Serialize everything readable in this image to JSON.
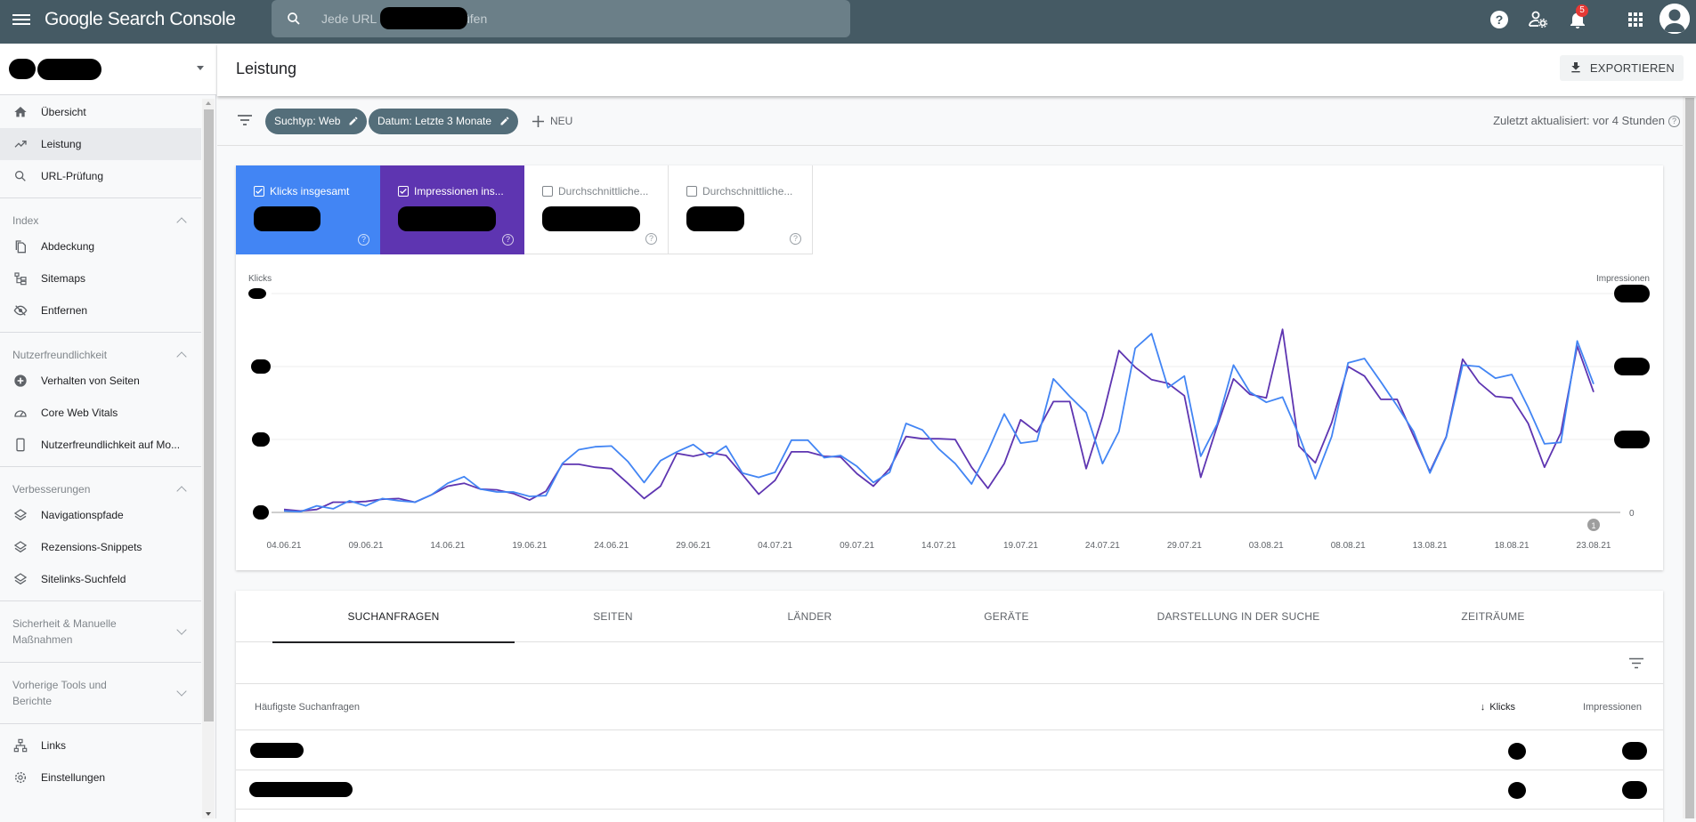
{
  "topbar": {
    "app_title": "Google Search Console",
    "search_placeholder": "Jede URL in [redacted] prüfen",
    "search_placeholder_prefix": "Jede URL in",
    "search_placeholder_suffix": "prüfen",
    "notification_count": "5",
    "icons": [
      "menu-icon",
      "search-icon",
      "help-icon",
      "user-settings-icon",
      "bell-icon",
      "apps-grid-icon",
      "account-avatar-icon"
    ]
  },
  "sidebar": {
    "property_redacted": true,
    "items_top": [
      {
        "label": "Übersicht",
        "icon": "home-icon"
      },
      {
        "label": "Leistung",
        "icon": "trending-up-icon",
        "active": true
      },
      {
        "label": "URL-Prüfung",
        "icon": "search-icon"
      }
    ],
    "sections": [
      {
        "title": "Index",
        "expanded": true,
        "items": [
          {
            "label": "Abdeckung",
            "icon": "copy-pages-icon"
          },
          {
            "label": "Sitemaps",
            "icon": "sitemap-icon"
          },
          {
            "label": "Entfernen",
            "icon": "visibility-off-icon"
          }
        ]
      },
      {
        "title": "Nutzerfreundlichkeit",
        "expanded": true,
        "items": [
          {
            "label": "Verhalten von Seiten",
            "icon": "add-circle-icon"
          },
          {
            "label": "Core Web Vitals",
            "icon": "speedometer-icon"
          },
          {
            "label": "Nutzerfreundlichkeit auf Mo...",
            "icon": "smartphone-icon"
          }
        ]
      },
      {
        "title": "Verbesserungen",
        "expanded": true,
        "items": [
          {
            "label": "Navigationspfade",
            "icon": "layers-icon"
          },
          {
            "label": "Rezensions-Snippets",
            "icon": "layers-icon"
          },
          {
            "label": "Sitelinks-Suchfeld",
            "icon": "layers-icon"
          }
        ]
      },
      {
        "title_line1": "Sicherheit & Manuelle",
        "title_line2": "Maßnahmen",
        "expanded": false
      },
      {
        "title_line1": "Vorherige Tools und",
        "title_line2": "Berichte",
        "expanded": false
      }
    ],
    "items_bottom": [
      {
        "label": "Links",
        "icon": "network-icon"
      },
      {
        "label": "Einstellungen",
        "icon": "gear-icon"
      }
    ]
  },
  "header": {
    "title": "Leistung",
    "export_label": "EXPORTIEREN"
  },
  "filters": {
    "chips": [
      "Suchtyp: Web",
      "Datum: Letzte 3 Monate"
    ],
    "new_label": "NEU",
    "updated_text": "Zuletzt aktualisiert: vor 4 Stunden"
  },
  "metrics": [
    {
      "label": "Klicks insgesamt",
      "checked": true,
      "color": "#4285f4",
      "value_redacted": true
    },
    {
      "label": "Impressionen ins...",
      "checked": true,
      "color": "#5e35b1",
      "value_redacted": true
    },
    {
      "label": "Durchschnittliche...",
      "checked": false,
      "value_redacted": true
    },
    {
      "label": "Durchschnittliche...",
      "checked": false,
      "value_redacted": true
    }
  ],
  "chart_data": {
    "type": "line",
    "left_axis_label": "Klicks",
    "right_axis_label": "Impressionen",
    "y_tick_labels_redacted": true,
    "y_units": "relative gridline units (0 = baseline, 3 = top gridline); actual tick values redacted",
    "ylim": [
      0,
      3
    ],
    "right_zero_label": "0",
    "grid": true,
    "annotation": "1",
    "annotation_date": "23.08.21",
    "x_tick_labels": [
      "04.06.21",
      "09.06.21",
      "14.06.21",
      "19.06.21",
      "24.06.21",
      "29.06.21",
      "04.07.21",
      "09.07.21",
      "14.07.21",
      "19.07.21",
      "24.07.21",
      "29.07.21",
      "03.08.21",
      "08.08.21",
      "13.08.21",
      "18.08.21",
      "23.08.21"
    ],
    "x_start": "04.06.21",
    "x_end": "24.08.21",
    "series": [
      {
        "name": "Klicks",
        "color": "#4285f4",
        "values": [
          0.02,
          0.01,
          0.09,
          0.05,
          0.16,
          0.09,
          0.19,
          0.16,
          0.14,
          0.24,
          0.4,
          0.49,
          0.32,
          0.28,
          0.28,
          0.22,
          0.23,
          0.67,
          0.86,
          0.9,
          0.91,
          0.7,
          0.41,
          0.71,
          0.83,
          0.93,
          0.76,
          0.91,
          0.54,
          0.48,
          0.55,
          0.99,
          0.99,
          0.75,
          0.78,
          0.63,
          0.41,
          0.55,
          1.22,
          1.13,
          0.87,
          0.67,
          0.39,
          0.84,
          1.35,
          0.95,
          0.98,
          1.83,
          1.59,
          1.37,
          0.67,
          1.11,
          2.25,
          2.45,
          1.71,
          1.87,
          0.77,
          1.21,
          2.02,
          1.65,
          1.51,
          1.58,
          1.06,
          0.46,
          1.04,
          2.05,
          2.11,
          1.79,
          1.46,
          1.11,
          0.54,
          1.03,
          2.02,
          2.0,
          1.84,
          1.89,
          1.44,
          0.94,
          0.96,
          2.35,
          1.76
        ]
      },
      {
        "name": "Impressionen",
        "color": "#5e35b1",
        "values": [
          0.04,
          0.02,
          0.04,
          0.14,
          0.14,
          0.15,
          0.18,
          0.19,
          0.14,
          0.24,
          0.36,
          0.4,
          0.32,
          0.31,
          0.26,
          0.17,
          0.29,
          0.66,
          0.66,
          0.62,
          0.6,
          0.4,
          0.19,
          0.36,
          0.81,
          0.77,
          0.82,
          0.78,
          0.52,
          0.25,
          0.44,
          0.83,
          0.83,
          0.77,
          0.76,
          0.53,
          0.36,
          0.6,
          1.04,
          1.01,
          1.01,
          1.0,
          0.62,
          0.33,
          0.67,
          1.27,
          1.1,
          1.52,
          1.52,
          0.6,
          1.31,
          2.22,
          1.99,
          1.82,
          1.77,
          1.6,
          0.48,
          1.18,
          1.83,
          1.62,
          1.57,
          2.51,
          0.91,
          0.68,
          1.23,
          2.0,
          1.87,
          1.55,
          1.55,
          1.05,
          0.56,
          1.04,
          2.1,
          1.78,
          1.59,
          1.57,
          1.22,
          0.62,
          1.09,
          2.28,
          1.65
        ]
      }
    ]
  },
  "table": {
    "tabs": [
      "SUCHANFRAGEN",
      "SEITEN",
      "LÄNDER",
      "GERÄTE",
      "DARSTELLUNG IN DER SUCHE",
      "ZEITRÄUME"
    ],
    "active_tab": 0,
    "columns": [
      "Häufigste Suchanfragen",
      "Klicks",
      "Impressionen"
    ],
    "sort_column": "Klicks",
    "sort_direction": "desc",
    "rows": [
      {
        "query_redacted": true,
        "klicks_redacted": true,
        "impressionen_redacted": true
      },
      {
        "query_redacted": true,
        "klicks_redacted": true,
        "impressionen_redacted": true
      }
    ]
  }
}
